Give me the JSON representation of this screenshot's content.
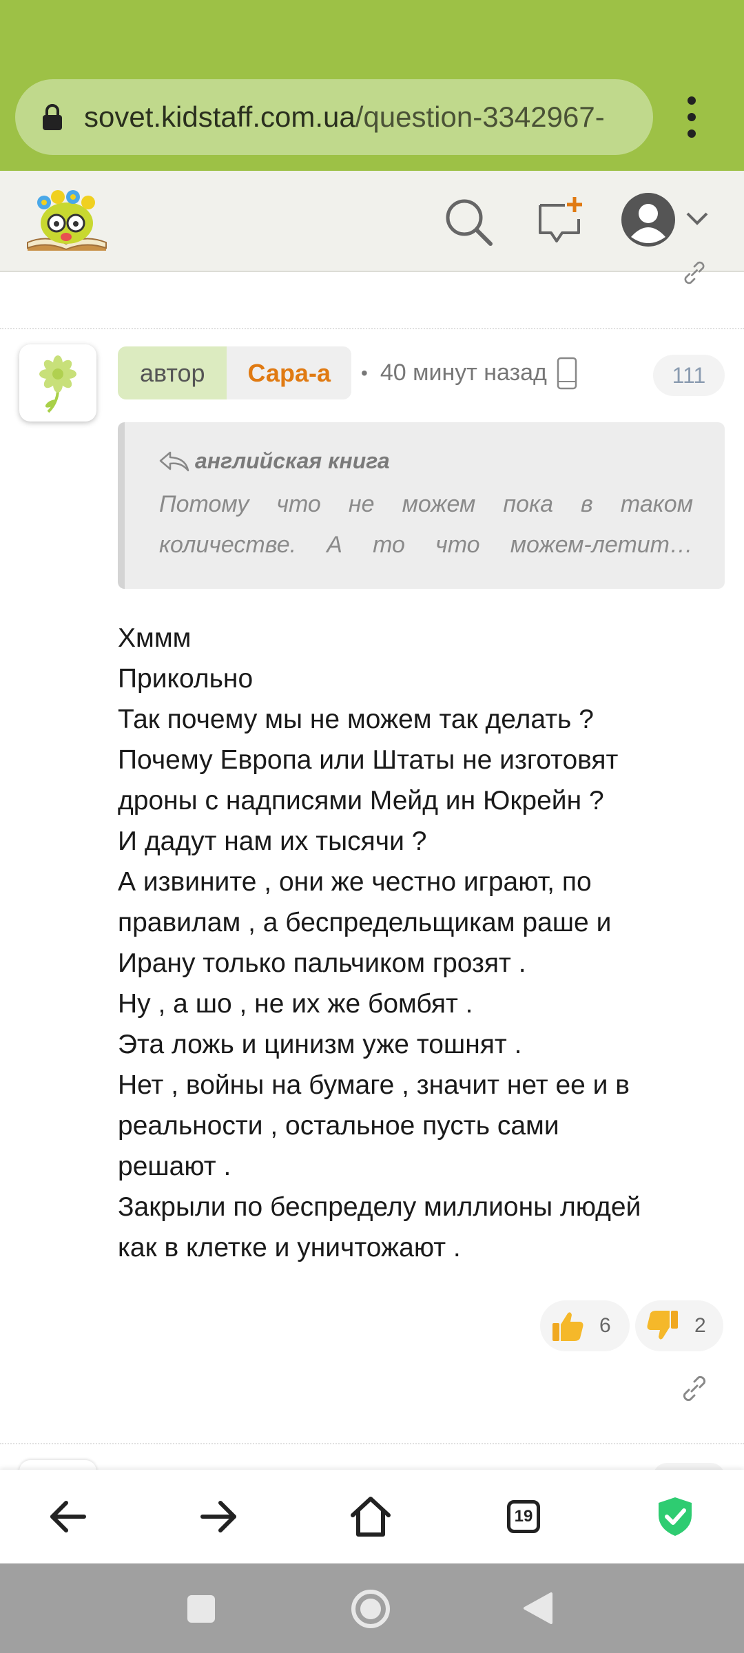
{
  "browser": {
    "url_domain": "sovet.kidstaff.com.ua",
    "url_path": "/question-3342967-",
    "tabs_count": "19"
  },
  "post": {
    "author_role": "автор",
    "author_name": "Сара-а",
    "time": "40 минут назад",
    "post_number": "111",
    "quote": {
      "title": "английская книга",
      "line1": "Потому что не можем пока в таком",
      "line2": "количестве. А то что можем-летит…"
    },
    "body_lines": [
      "Хммм",
      "Прикольно",
      "Так почему мы не можем так делать ?",
      "Почему Европа или Штаты не изготовят",
      "дроны с надписями Мейд ин Юкрейн ?",
      "И дадут нам их тысячи ?",
      "А извините , они же честно играют, по",
      "правилам , а беспредельщикам раше и",
      "Ирану только пальчиком грозят .",
      "Ну , а шо , не их же бомбят .",
      "Эта ложь и цинизм уже тошнят .",
      "Нет , войны на бумаге , значит нет ее и в",
      "реальности , остальное пусть сами",
      "решают .",
      "Закрыли по беспределу миллионы людей",
      "как в клетке и уничтожают ."
    ],
    "likes": "6",
    "dislikes": "2"
  },
  "colors": {
    "browser_bar": "#9dc146",
    "author_name": "#e07a12",
    "shield": "#2ecc71"
  },
  "icons": [
    "lock-icon",
    "menu-dots-icon",
    "search-icon",
    "new-question-icon",
    "user-avatar-icon",
    "chevron-down-icon",
    "link-icon",
    "reply-arrow-icon",
    "phone-icon",
    "thumbs-up-icon",
    "thumbs-down-icon",
    "back-arrow-icon",
    "forward-arrow-icon",
    "home-icon",
    "tabs-icon",
    "shield-check-icon"
  ]
}
